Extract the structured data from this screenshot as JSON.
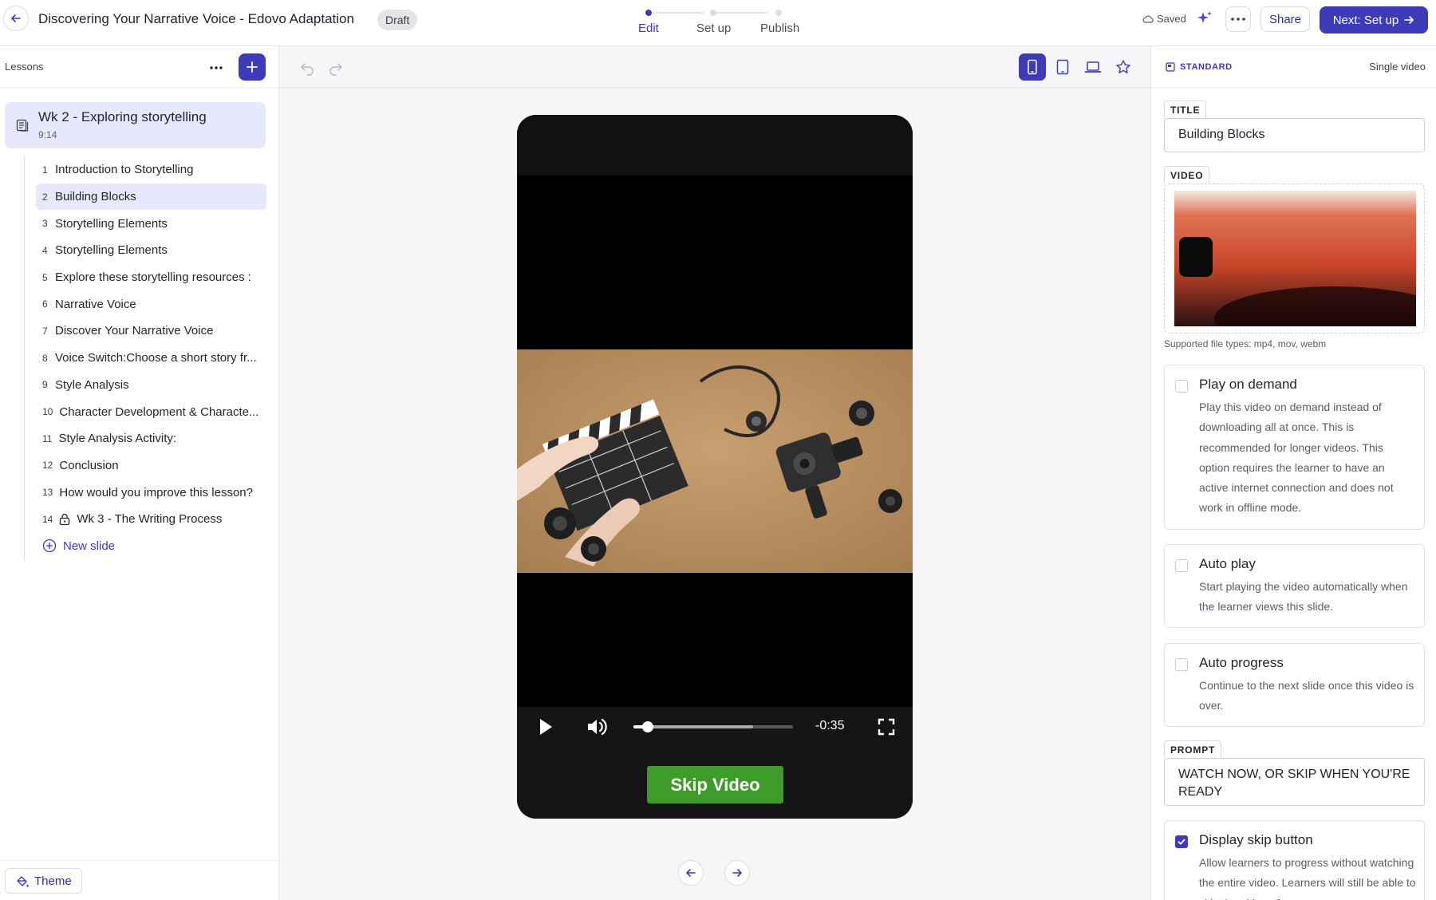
{
  "header": {
    "title": "Discovering Your Narrative Voice - Edovo Adaptation",
    "status_badge": "Draft",
    "steps": [
      {
        "label": "Edit",
        "active": true
      },
      {
        "label": "Set up",
        "active": false
      },
      {
        "label": "Publish",
        "active": false
      }
    ],
    "saved_label": "Saved",
    "share_label": "Share",
    "next_label": "Next: Set up"
  },
  "sidebar": {
    "header_label": "Lessons",
    "lesson": {
      "title": "Wk 2 - Exploring storytelling",
      "duration": "9:14"
    },
    "slides": [
      {
        "num": "1",
        "label": "Introduction to Storytelling"
      },
      {
        "num": "2",
        "label": "Building Blocks",
        "selected": true
      },
      {
        "num": "3",
        "label": "Storytelling Elements"
      },
      {
        "num": "4",
        "label": "Storytelling Elements"
      },
      {
        "num": "5",
        "label": "Explore these storytelling resources :"
      },
      {
        "num": "6",
        "label": "Narrative Voice"
      },
      {
        "num": "7",
        "label": "Discover Your Narrative Voice"
      },
      {
        "num": "8",
        "label": "Voice Switch:Choose a short story fr..."
      },
      {
        "num": "9",
        "label": "Style Analysis"
      },
      {
        "num": "10",
        "label": "Character Development & Characte..."
      },
      {
        "num": "11",
        "label": "Style Analysis Activity:"
      },
      {
        "num": "12",
        "label": "Conclusion"
      },
      {
        "num": "13",
        "label": "How would you improve this lesson?"
      },
      {
        "num": "14",
        "label": "Wk 3 - The Writing Process",
        "locked": true
      }
    ],
    "new_slide_label": "New slide",
    "theme_label": "Theme"
  },
  "canvas": {
    "preview": {
      "time_remaining": "-0:35",
      "progress": 0.09,
      "buffered": 0.75,
      "skip_label": "Skip Video"
    }
  },
  "panel": {
    "mode_label": "STANDARD",
    "type_label": "Single video",
    "title_tag": "TITLE",
    "title_value": "Building Blocks",
    "video_tag": "VIDEO",
    "file_types": "Supported file types: mp4, mov, webm",
    "options": [
      {
        "title": "Play on demand",
        "checked": false,
        "desc": "Play this video on demand instead of downloading all at once. This is recommended for longer videos. This option requires the learner to have an active internet connection and does not work in offline mode."
      },
      {
        "title": "Auto play",
        "checked": false,
        "desc": "Start playing the video automatically when the learner views this slide."
      },
      {
        "title": "Auto progress",
        "checked": false,
        "desc": "Continue to the next slide once this video is over."
      }
    ],
    "prompt_tag": "PROMPT",
    "prompt_value": "WATCH NOW, OR SKIP WHEN YOU'RE READY",
    "skip_option": {
      "title": "Display skip button",
      "checked": true,
      "desc": "Allow learners to progress without watching the entire video. Learners will still be able to skip the video after"
    }
  },
  "colors": {
    "accent": "#3d3bb8",
    "skip_green": "#3f9c2b",
    "selected_bg": "#e7e8fb"
  }
}
